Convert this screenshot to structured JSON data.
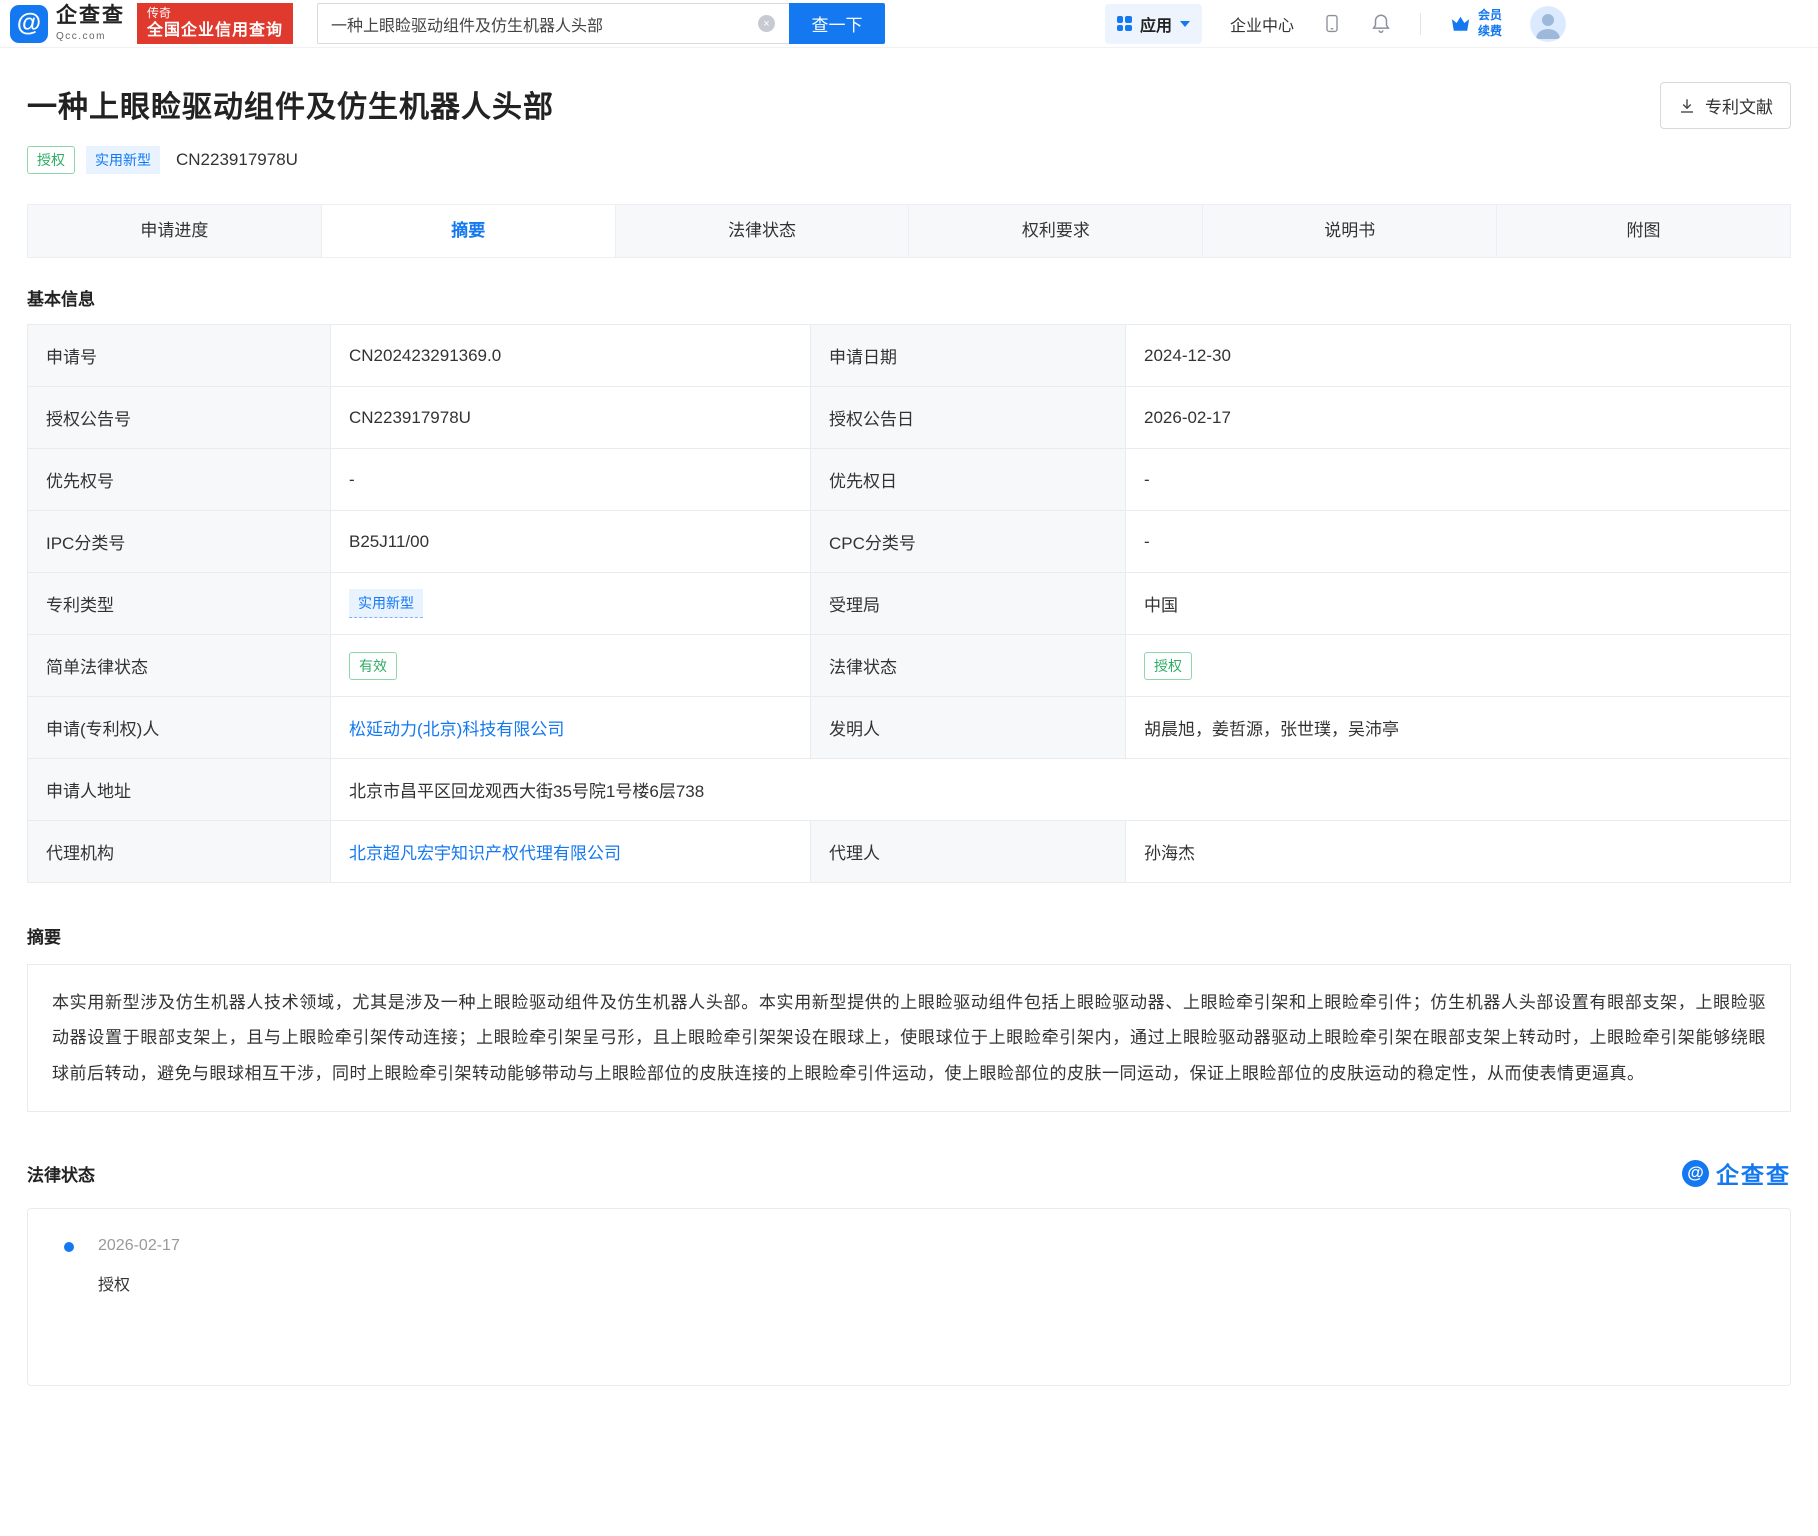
{
  "brand": {
    "name": "企查查",
    "domain": "Qcc.com",
    "slogan_tag": "传奇",
    "slogan": "全国企业信用查询"
  },
  "topbar": {
    "search_value": "一种上眼睑驱动组件及仿生机器人头部",
    "search_button": "查一下",
    "app_label": "应用",
    "enterprise_center": "企业中心",
    "vip_line1": "会员",
    "vip_line2": "续费"
  },
  "patent": {
    "title": "一种上眼睑驱动组件及仿生机器人头部",
    "grant_tag": "授权",
    "type_tag": "实用新型",
    "publication_no": "CN223917978U",
    "doc_button": "专利文献"
  },
  "tabs": {
    "items": [
      "申请进度",
      "摘要",
      "法律状态",
      "权利要求",
      "说明书",
      "附图"
    ]
  },
  "basic_info": {
    "heading": "基本信息",
    "rows": [
      {
        "l1": "申请号",
        "v1": "CN202423291369.0",
        "l2": "申请日期",
        "v2": "2024-12-30"
      },
      {
        "l1": "授权公告号",
        "v1": "CN223917978U",
        "l2": "授权公告日",
        "v2": "2026-02-17"
      },
      {
        "l1": "优先权号",
        "v1": "-",
        "l2": "优先权日",
        "v2": "-"
      },
      {
        "l1": "IPC分类号",
        "v1": "B25J11/00",
        "l2": "CPC分类号",
        "v2": "-"
      },
      {
        "l1": "专利类型",
        "v1": "实用新型",
        "l2": "受理局",
        "v2": "中国"
      },
      {
        "l1": "简单法律状态",
        "v1": "有效",
        "l2": "法律状态",
        "v2": "授权"
      },
      {
        "l1": "申请(专利权)人",
        "v1": "松延动力(北京)科技有限公司",
        "l2": "发明人",
        "v2": "胡晨旭，姜哲源，张世璞，吴沛亭"
      },
      {
        "l1": "申请人地址",
        "v1": "北京市昌平区回龙观西大街35号院1号楼6层738"
      },
      {
        "l1": "代理机构",
        "v1": "北京超凡宏宇知识产权代理有限公司",
        "l2": "代理人",
        "v2": "孙海杰"
      }
    ]
  },
  "abstract": {
    "heading": "摘要",
    "text": "本实用新型涉及仿生机器人技术领域，尤其是涉及一种上眼睑驱动组件及仿生机器人头部。本实用新型提供的上眼睑驱动组件包括上眼睑驱动器、上眼睑牵引架和上眼睑牵引件；仿生机器人头部设置有眼部支架，上眼睑驱动器设置于眼部支架上，且与上眼睑牵引架传动连接；上眼睑牵引架呈弓形，且上眼睑牵引架架设在眼球上，使眼球位于上眼睑牵引架内，通过上眼睑驱动器驱动上眼睑牵引架在眼部支架上转动时，上眼睑牵引架能够绕眼球前后转动，避免与眼球相互干涉，同时上眼睑牵引架转动能够带动与上眼睑部位的皮肤连接的上眼睑牵引件运动，使上眼睑部位的皮肤一同运动，保证上眼睑部位的皮肤运动的稳定性，从而使表情更逼真。"
  },
  "legal": {
    "heading": "法律状态",
    "watermark": "企查查",
    "items": [
      {
        "date": "2026-02-17",
        "status": "授权"
      }
    ]
  },
  "colors": {
    "brand_blue": "#1478f0",
    "badge_red": "#e0392e",
    "tag_green": "#2fae64",
    "label_bg": "#f7f8fa"
  }
}
